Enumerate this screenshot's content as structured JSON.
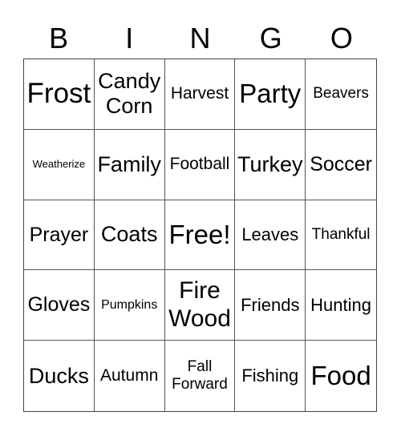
{
  "header": [
    "B",
    "I",
    "N",
    "G",
    "O"
  ],
  "cells": [
    [
      "Frost",
      "Candy Corn",
      "Harvest",
      "Party",
      "Beavers"
    ],
    [
      "Weatherize",
      "Family",
      "Football",
      "Turkey",
      "Soccer"
    ],
    [
      "Prayer",
      "Coats",
      "Free!",
      "Leaves",
      "Thankful"
    ],
    [
      "Gloves",
      "Pumpkins",
      "Fire Wood",
      "Friends",
      "Hunting"
    ],
    [
      "Ducks",
      "Autumn",
      "Fall Forward",
      "Fishing",
      "Food"
    ]
  ]
}
